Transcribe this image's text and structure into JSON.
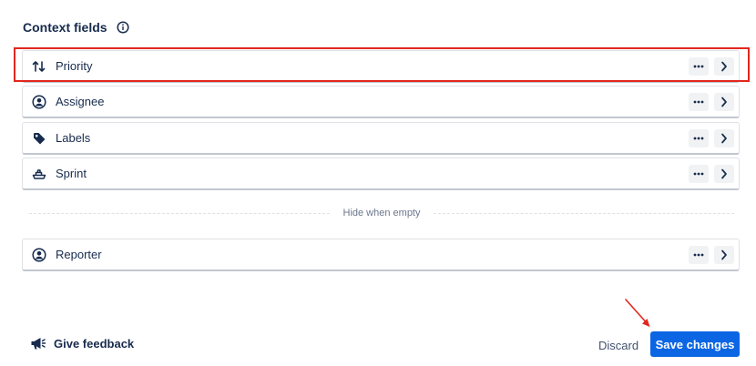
{
  "header": {
    "title": "Context fields",
    "info_icon": "info-icon"
  },
  "fields": [
    {
      "label": "Priority",
      "icon": "priority-icon"
    },
    {
      "label": "Assignee",
      "icon": "user-avatar-icon"
    },
    {
      "label": "Labels",
      "icon": "tag-icon"
    },
    {
      "label": "Sprint",
      "icon": "sprint-boat-icon"
    }
  ],
  "divider": {
    "label": "Hide when empty"
  },
  "hidden_fields": [
    {
      "label": "Reporter",
      "icon": "user-avatar-icon"
    }
  ],
  "footer": {
    "feedback_label": "Give feedback",
    "discard_label": "Discard",
    "save_label": "Save changes"
  },
  "colors": {
    "primary_button": "#0c66e4",
    "annotation_red": "#e2261d",
    "text": "#172b4d"
  }
}
